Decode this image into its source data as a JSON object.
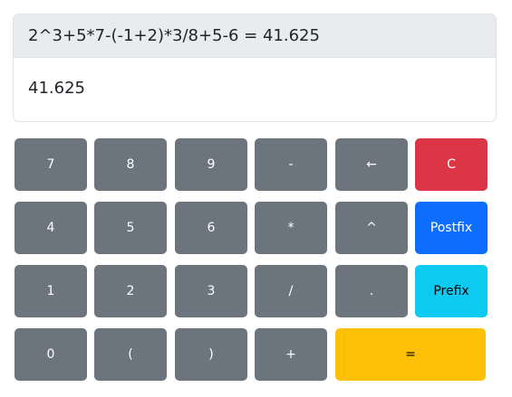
{
  "display": {
    "expression": "2^3+5*7-(-1+2)*3/8+5-6 = 41.625",
    "result": "41.625"
  },
  "keys": {
    "k7": "7",
    "k8": "8",
    "k9": "9",
    "minus": "-",
    "backspace": "←",
    "clear": "C",
    "k4": "4",
    "k5": "5",
    "k6": "6",
    "multiply": "*",
    "power": "^",
    "postfix": "Postfix",
    "k1": "1",
    "k2": "2",
    "k3": "3",
    "divide": "/",
    "dot": ".",
    "prefix": "Prefix",
    "k0": "0",
    "lparen": "(",
    "rparen": ")",
    "plus": "+",
    "equals": "="
  },
  "colors": {
    "gray": "#6c757d",
    "danger": "#dc3545",
    "primary": "#0d6efd",
    "info": "#0dcaf0",
    "warning": "#ffc107"
  }
}
